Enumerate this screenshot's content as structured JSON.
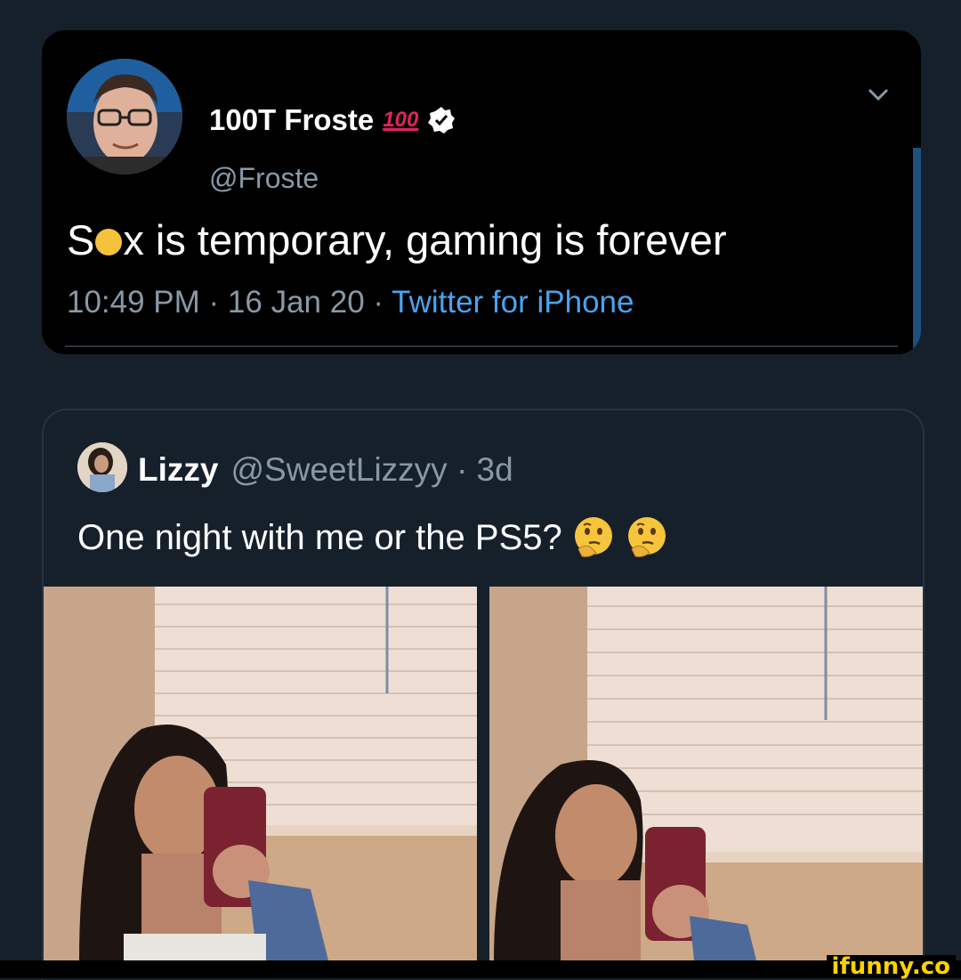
{
  "tweet1": {
    "name": "100T Froste",
    "hundred": "100",
    "handle": "@Froste",
    "text_before": "S",
    "text_after": "x is temporary, gaming is forever",
    "time": "10:49 PM · 16 Jan 20 · ",
    "source": "Twitter for iPhone"
  },
  "tweet2": {
    "name": "Lizzy",
    "handle": "@SweetLizzyy · 3d",
    "text": "One night with me or the PS5?"
  },
  "watermark": "ifunny.co",
  "colors": {
    "background": "#16202b",
    "card": "#000000",
    "handle_gray": "#8899a6",
    "link_blue": "#4aa3f0",
    "hundred_red": "#e0245e",
    "watermark_yellow": "#ffd200"
  }
}
